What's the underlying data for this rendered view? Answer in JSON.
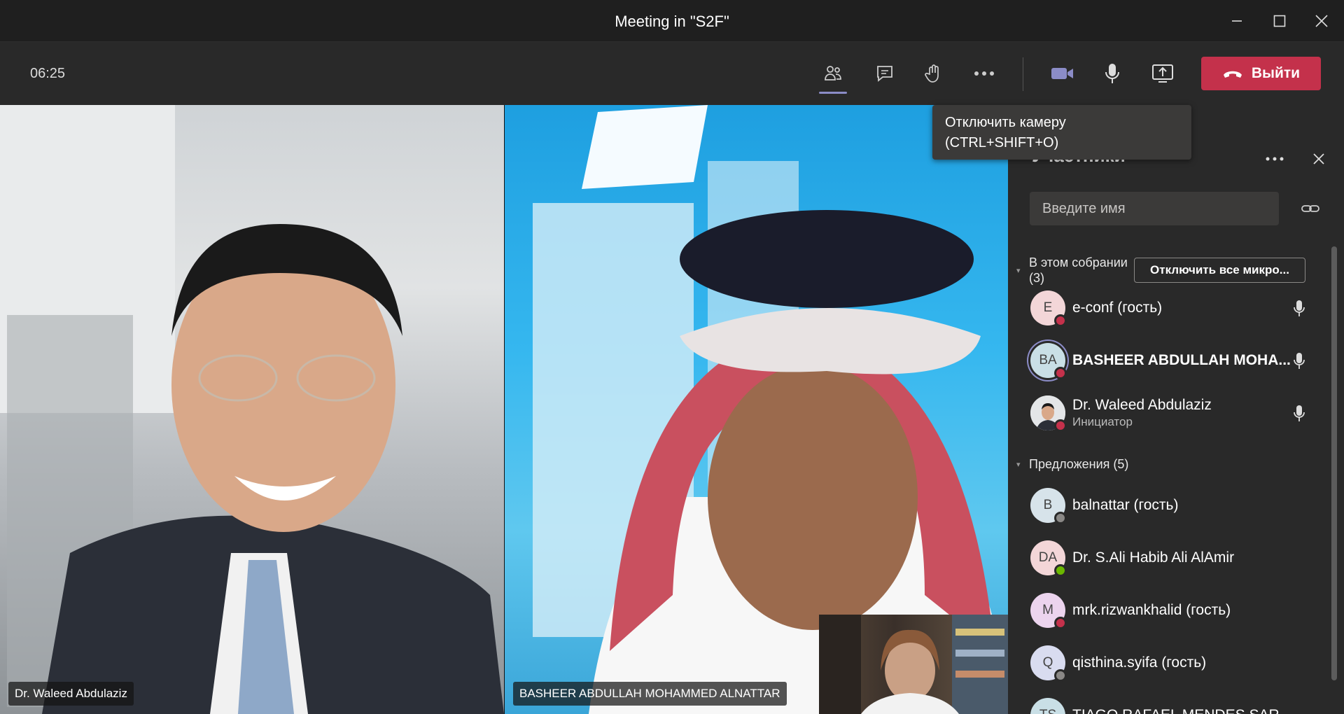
{
  "window": {
    "title": "Meeting in \"S2F\"",
    "controls": [
      "minimize-icon",
      "maximize-icon",
      "close-icon"
    ]
  },
  "toolbar": {
    "timer": "06:25",
    "buttons": [
      "participants-icon",
      "chat-icon",
      "raise-hand-icon",
      "more-icon",
      "camera-icon",
      "microphone-icon",
      "share-screen-icon"
    ],
    "leave_label": "Выйти",
    "leave_color": "#c4314b",
    "active_indicator_color": "#8b8cc7"
  },
  "tooltip": {
    "line1": "Отключить камеру",
    "line2": "(CTRL+SHIFT+O)"
  },
  "videos": {
    "left_name": "Dr. Waleed Abdulaziz",
    "right_name": "BASHEER ABDULLAH MOHAMMED ALNATTAR"
  },
  "panel": {
    "title": "Участники",
    "search_placeholder": "Введите имя",
    "in_meeting_label": "В этом собрании",
    "in_meeting_count": "(3)",
    "mute_all_label": "Отключить все микро...",
    "suggestions_label": "Предложения (5)",
    "in_meeting": [
      {
        "initials": "E",
        "name": "e-conf (гость)",
        "avatar_bg": "#f3d6d8",
        "status_color": "#c4314b"
      },
      {
        "initials": "BA",
        "name": "BASHEER ABDULLAH MOHA...",
        "avatar_bg": "#c9dfe6",
        "status_color": "#c4314b"
      },
      {
        "initials": "",
        "name": "Dr. Waleed Abdulaziz",
        "role": "Инициатор",
        "avatar_bg": "#d8dde2",
        "status_color": "#c4314b"
      }
    ],
    "suggestions": [
      {
        "initials": "B",
        "name": "balnattar (гость)",
        "avatar_bg": "#d7e3ea",
        "status_color": "#8a8886"
      },
      {
        "initials": "DA",
        "name": "Dr. S.Ali Habib Ali AlAmir",
        "avatar_bg": "#f3d6d8",
        "status_color": "#6bb700"
      },
      {
        "initials": "M",
        "name": "mrk.rizwankhalid (гость)",
        "avatar_bg": "#ecd4ee",
        "status_color": "#c4314b"
      },
      {
        "initials": "Q",
        "name": "qisthina.syifa (гость)",
        "avatar_bg": "#d9dcf0",
        "status_color": "#8a8886"
      },
      {
        "initials": "TS",
        "name": "TIAGO RAFAEL MENDES SARAIVA",
        "avatar_bg": "#c9dfe6",
        "status_color": "#8a8886"
      }
    ]
  }
}
